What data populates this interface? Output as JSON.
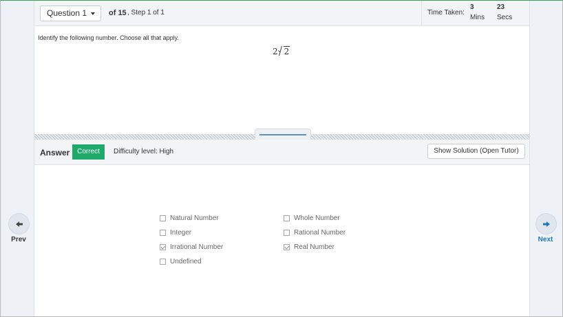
{
  "header": {
    "question_select": "Question 1",
    "of_count": "of 15",
    "step": ", Step 1 of 1",
    "time_taken_label": "Time Taken:",
    "time_minutes": "3",
    "time_minutes_unit": "Mins",
    "time_seconds": "23",
    "time_seconds_unit": "Secs"
  },
  "question": {
    "prompt": "Identify the following number. Choose all that apply.",
    "expression_coefficient": "2",
    "expression_radicand": "2"
  },
  "answer": {
    "label": "Answer",
    "status": "Correct",
    "status_color": "#1faa6c",
    "difficulty": "Difficulty level: High",
    "solution_button": "Show Solution (Open Tutor)"
  },
  "choices": [
    {
      "label": "Natural Number",
      "checked": false
    },
    {
      "label": "Whole Number",
      "checked": false
    },
    {
      "label": "Integer",
      "checked": false
    },
    {
      "label": "Rational Number",
      "checked": false
    },
    {
      "label": "Irrational Number",
      "checked": true
    },
    {
      "label": "Real Number",
      "checked": true
    },
    {
      "label": "Undefined",
      "checked": false
    }
  ],
  "nav": {
    "prev_label": "Prev",
    "next_label": "Next",
    "next_color": "#1f76b5"
  }
}
